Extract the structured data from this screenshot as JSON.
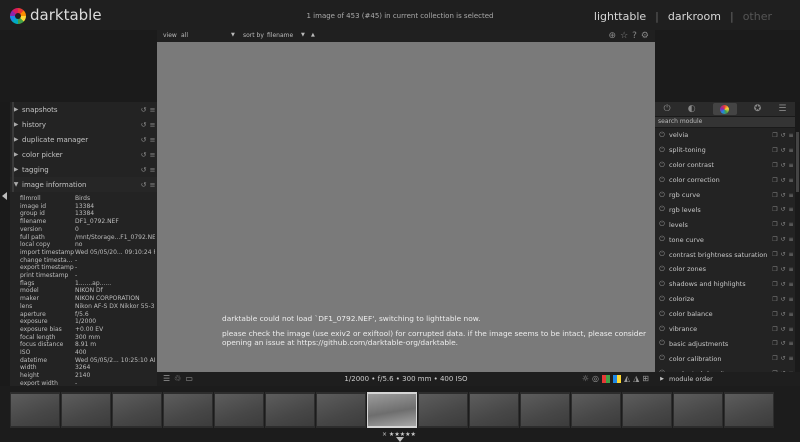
{
  "app": {
    "title": "darktable"
  },
  "header": {
    "status": "1 image of 453 (#45) in current collection is selected",
    "views": [
      {
        "label": "lighttable"
      },
      {
        "label": "darkroom"
      },
      {
        "label": "other"
      }
    ],
    "separator": "|"
  },
  "left_panel": {
    "modules": [
      {
        "label": "snapshots"
      },
      {
        "label": "history"
      },
      {
        "label": "duplicate manager"
      },
      {
        "label": "color picker"
      },
      {
        "label": "tagging"
      },
      {
        "label": "image information"
      }
    ],
    "image_info": [
      {
        "key": "filmroll",
        "value": "Birds"
      },
      {
        "key": "image id",
        "value": "13384"
      },
      {
        "key": "group id",
        "value": "13384"
      },
      {
        "key": "filename",
        "value": "DF1_0792.NEF"
      },
      {
        "key": "version",
        "value": "0"
      },
      {
        "key": "full path",
        "value": "/mnt/Storage...F1_0792.NEF"
      },
      {
        "key": "local copy",
        "value": "no"
      },
      {
        "key": "import timestamp",
        "value": "Wed 05/05/20... 09:10:24 PM"
      },
      {
        "key": "change timesta...",
        "value": "-"
      },
      {
        "key": "export timestamp",
        "value": "-"
      },
      {
        "key": "print timestamp",
        "value": "-"
      },
      {
        "key": "flags",
        "value": "1.......ap......"
      },
      {
        "key": "model",
        "value": "NIKON Df"
      },
      {
        "key": "maker",
        "value": "NIKON CORPORATION"
      },
      {
        "key": "lens",
        "value": "Nikon AF-S DX Nikkor 55-3..."
      },
      {
        "key": "aperture",
        "value": "f/5.6"
      },
      {
        "key": "exposure",
        "value": "1/2000"
      },
      {
        "key": "exposure bias",
        "value": "+0.00 EV"
      },
      {
        "key": "focal length",
        "value": "300 mm"
      },
      {
        "key": "focus distance",
        "value": "8.91 m"
      },
      {
        "key": "ISO",
        "value": "400"
      },
      {
        "key": "datetime",
        "value": "Wed 05/05/2... 10:25:10 AM"
      },
      {
        "key": "width",
        "value": "3264"
      },
      {
        "key": "height",
        "value": "2140"
      },
      {
        "key": "export width",
        "value": "-"
      }
    ]
  },
  "center": {
    "toolbar": {
      "view_label": "view",
      "view_value": "all",
      "sort_label": "sort by",
      "sort_value": "filename",
      "sort_dir": "▲"
    },
    "error": {
      "line1": "darktable could not load `DF1_0792.NEF', switching to lighttable now.",
      "line2": "please check the image (use exiv2 or exiftool) for corrupted data. if the image seems to be intact, please consider opening an issue at https://github.com/darktable-org/darktable."
    },
    "exif_summary": "1/2000 • f/5.6 • 300 mm • 400 ISO"
  },
  "right_panel": {
    "search_placeholder": "search module",
    "modules": [
      {
        "label": "velvia"
      },
      {
        "label": "split-toning"
      },
      {
        "label": "color contrast"
      },
      {
        "label": "color correction"
      },
      {
        "label": "rgb curve"
      },
      {
        "label": "rgb levels"
      },
      {
        "label": "levels"
      },
      {
        "label": "tone curve"
      },
      {
        "label": "contrast brightness saturation"
      },
      {
        "label": "color zones"
      },
      {
        "label": "shadows and highlights"
      },
      {
        "label": "colorize"
      },
      {
        "label": "color balance"
      },
      {
        "label": "vibrance"
      },
      {
        "label": "basic adjustments"
      },
      {
        "label": "color calibration"
      },
      {
        "label": "graduated density"
      }
    ],
    "module_order": "module order"
  },
  "filmstrip": {
    "count": 15,
    "selected_index": 7,
    "selected_caption": "×  ★★★★★"
  },
  "colors": {
    "canvas": "#7a7a7a",
    "panel": "#232323",
    "background": "#1a1a1a"
  }
}
